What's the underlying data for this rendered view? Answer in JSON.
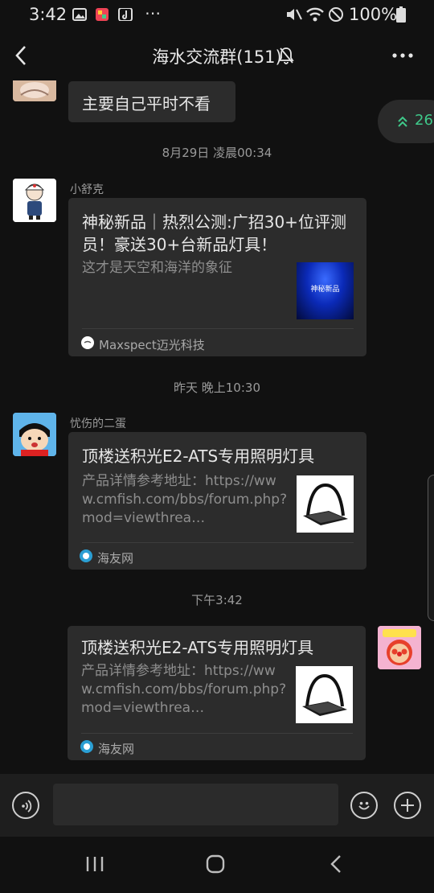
{
  "status_bar": {
    "time": "3:42",
    "battery": "100%"
  },
  "header": {
    "title": "海水交流群(151)"
  },
  "unread_pill": {
    "count": "26"
  },
  "messages": [
    {
      "type": "text",
      "text": "主要自己平时不看"
    },
    {
      "type": "timestamp",
      "text": "8月29日 凌晨00:34"
    },
    {
      "type": "card",
      "sender": "小舒克",
      "title": "神秘新品｜热烈公测:广招30+位评测员！豪送30+台新品灯具！",
      "description": "这才是天空和海洋的象征",
      "thumb_text": "神秘新品",
      "source": "Maxspect迈光科技"
    },
    {
      "type": "timestamp",
      "text": "昨天 晚上10:30"
    },
    {
      "type": "card",
      "sender": "忧伤的二蛋",
      "title": "顶楼送积光E2-ATS专用照明灯具",
      "description": "产品详情参考地址：https://www.cmfish.com/bbs/forum.php?mod=viewthrea…",
      "source": "海友网"
    },
    {
      "type": "timestamp",
      "text": "下午3:42"
    },
    {
      "type": "card",
      "title": "顶楼送积光E2-ATS专用照明灯具",
      "description": "产品详情参考地址：https://www.cmfish.com/bbs/forum.php?mod=viewthrea…",
      "source": "海友网"
    }
  ],
  "colors": {
    "background": "#111111",
    "bubble": "#2c2c2c",
    "accent_green": "#3fc98a"
  }
}
